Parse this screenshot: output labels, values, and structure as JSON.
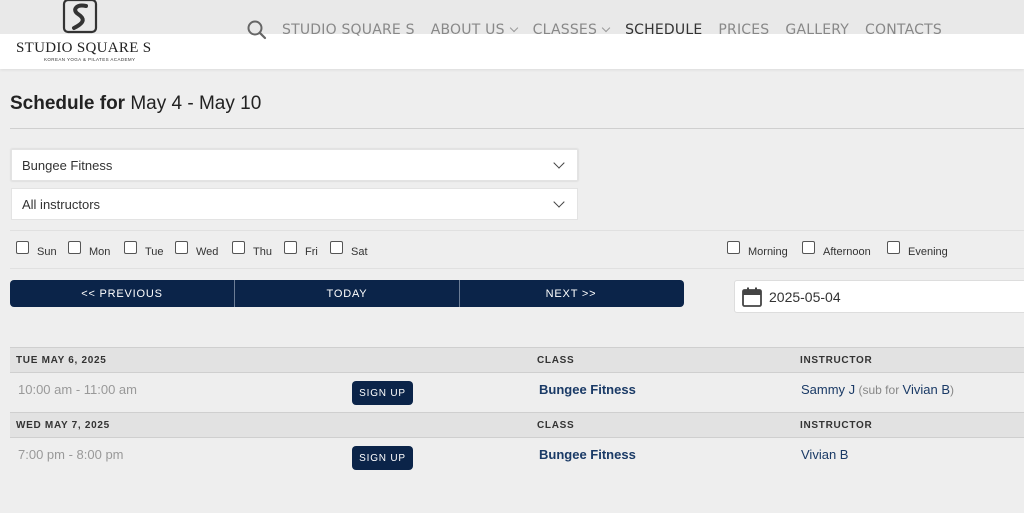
{
  "header": {
    "logo_text": "STUDIO SQUARE S",
    "logo_sub": "KOREAN YOGA & PILATES ACADEMY",
    "nav": [
      {
        "label": "STUDIO SQUARE S",
        "dropdown": false,
        "active": false
      },
      {
        "label": "ABOUT US",
        "dropdown": true,
        "active": false
      },
      {
        "label": "CLASSES",
        "dropdown": true,
        "active": false
      },
      {
        "label": "SCHEDULE",
        "dropdown": false,
        "active": true
      },
      {
        "label": "PRICES",
        "dropdown": false,
        "active": false
      },
      {
        "label": "GALLERY",
        "dropdown": false,
        "active": false
      },
      {
        "label": "CONTACTS",
        "dropdown": false,
        "active": false
      }
    ]
  },
  "title": {
    "prefix": "Schedule for",
    "range": "May 4 - May 10"
  },
  "filters": {
    "class_select": "Bungee Fitness",
    "instructor_select": "All instructors",
    "days": [
      "Sun",
      "Mon",
      "Tue",
      "Wed",
      "Thu",
      "Fri",
      "Sat"
    ],
    "times": [
      "Morning",
      "Afternoon",
      "Evening"
    ]
  },
  "nav_buttons": {
    "previous": "<< PREVIOUS",
    "today": "TODAY",
    "next": "NEXT >>"
  },
  "date_input": "2025-05-04",
  "schedule": {
    "class_header": "CLASS",
    "instructor_header": "INSTRUCTOR",
    "signup_label": "SIGN UP",
    "days": [
      {
        "date": "TUE MAY 6, 2025",
        "time": "10:00 am - 11:00 am",
        "class": "Bungee Fitness",
        "instructor": "Sammy J",
        "sub_prefix": " (sub for ",
        "sub_name": "Vivian B",
        "sub_suffix": ")"
      },
      {
        "date": "WED MAY 7, 2025",
        "time": "7:00 pm - 8:00 pm",
        "class": "Bungee Fitness",
        "instructor": "Vivian B"
      }
    ]
  },
  "colors": {
    "primary": "#0b2449",
    "link": "#1a3a66"
  }
}
